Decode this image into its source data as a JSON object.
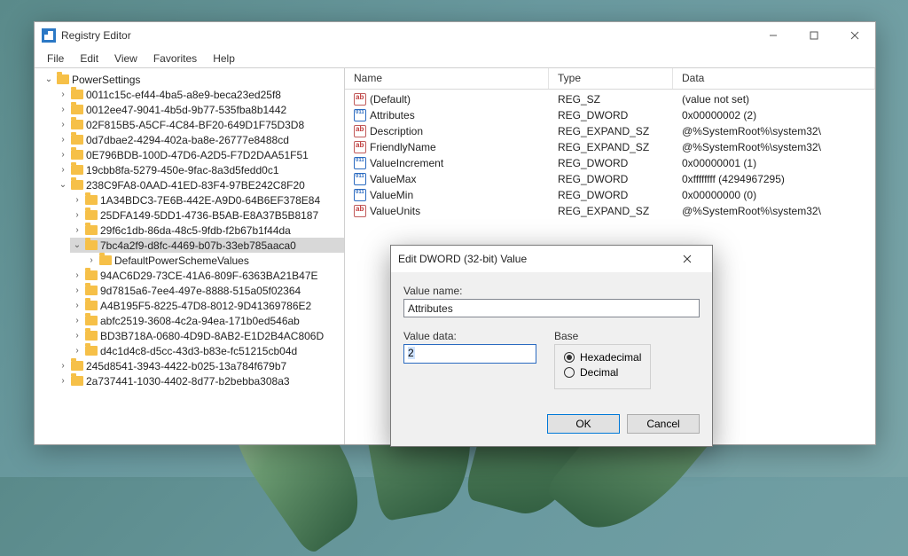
{
  "window": {
    "title": "Registry Editor",
    "menu": [
      "File",
      "Edit",
      "View",
      "Favorites",
      "Help"
    ],
    "minimize": "–",
    "maximize": "□",
    "close": "✕"
  },
  "tree": {
    "root_label": "PowerSettings",
    "root_children": [
      {
        "label": "0011c15c-ef44-4ba5-a8e9-beca23ed25f8"
      },
      {
        "label": "0012ee47-9041-4b5d-9b77-535fba8b1442"
      },
      {
        "label": "02F815B5-A5CF-4C84-BF20-649D1F75D3D8"
      },
      {
        "label": "0d7dbae2-4294-402a-ba8e-26777e8488cd"
      },
      {
        "label": "0E796BDB-100D-47D6-A2D5-F7D2DAA51F51"
      },
      {
        "label": "19cbb8fa-5279-450e-9fac-8a3d5fedd0c1"
      }
    ],
    "open_child_label": "238C9FA8-0AAD-41ED-83F4-97BE242C8F20",
    "open_child_children": [
      {
        "label": "1A34BDC3-7E6B-442E-A9D0-64B6EF378E84"
      },
      {
        "label": "25DFA149-5DD1-4736-B5AB-E8A37B5B8187"
      },
      {
        "label": "29f6c1db-86da-48c5-9fdb-f2b67b1f44da"
      }
    ],
    "selected_label": "7bc4a2f9-d8fc-4469-b07b-33eb785aaca0",
    "selected_child": {
      "label": "DefaultPowerSchemeValues"
    },
    "after_selected": [
      {
        "label": "94AC6D29-73CE-41A6-809F-6363BA21B47E"
      },
      {
        "label": "9d7815a6-7ee4-497e-8888-515a05f02364"
      },
      {
        "label": "A4B195F5-8225-47D8-8012-9D41369786E2"
      },
      {
        "label": "abfc2519-3608-4c2a-94ea-171b0ed546ab"
      },
      {
        "label": "BD3B718A-0680-4D9D-8AB2-E1D2B4AC806D"
      },
      {
        "label": "d4c1d4c8-d5cc-43d3-b83e-fc51215cb04d"
      }
    ],
    "tail": [
      {
        "label": "245d8541-3943-4422-b025-13a784f679b7"
      },
      {
        "label": "2a737441-1030-4402-8d77-b2bebba308a3"
      }
    ]
  },
  "columns": {
    "name": "Name",
    "type": "Type",
    "data": "Data"
  },
  "values": [
    {
      "icon": "sz",
      "name": "(Default)",
      "type": "REG_SZ",
      "data": "(value not set)"
    },
    {
      "icon": "bin",
      "name": "Attributes",
      "type": "REG_DWORD",
      "data": "0x00000002 (2)"
    },
    {
      "icon": "sz",
      "name": "Description",
      "type": "REG_EXPAND_SZ",
      "data": "@%SystemRoot%\\system32\\"
    },
    {
      "icon": "sz",
      "name": "FriendlyName",
      "type": "REG_EXPAND_SZ",
      "data": "@%SystemRoot%\\system32\\"
    },
    {
      "icon": "bin",
      "name": "ValueIncrement",
      "type": "REG_DWORD",
      "data": "0x00000001 (1)"
    },
    {
      "icon": "bin",
      "name": "ValueMax",
      "type": "REG_DWORD",
      "data": "0xffffffff (4294967295)"
    },
    {
      "icon": "bin",
      "name": "ValueMin",
      "type": "REG_DWORD",
      "data": "0x00000000 (0)"
    },
    {
      "icon": "sz",
      "name": "ValueUnits",
      "type": "REG_EXPAND_SZ",
      "data": "@%SystemRoot%\\system32\\"
    }
  ],
  "dialog": {
    "title": "Edit DWORD (32-bit) Value",
    "value_name_label": "Value name:",
    "value_name": "Attributes",
    "value_data_label": "Value data:",
    "value_data": "2",
    "base_label": "Base",
    "base_options": {
      "hex": "Hexadecimal",
      "dec": "Decimal"
    },
    "base_selected": "hex",
    "ok": "OK",
    "cancel": "Cancel"
  }
}
